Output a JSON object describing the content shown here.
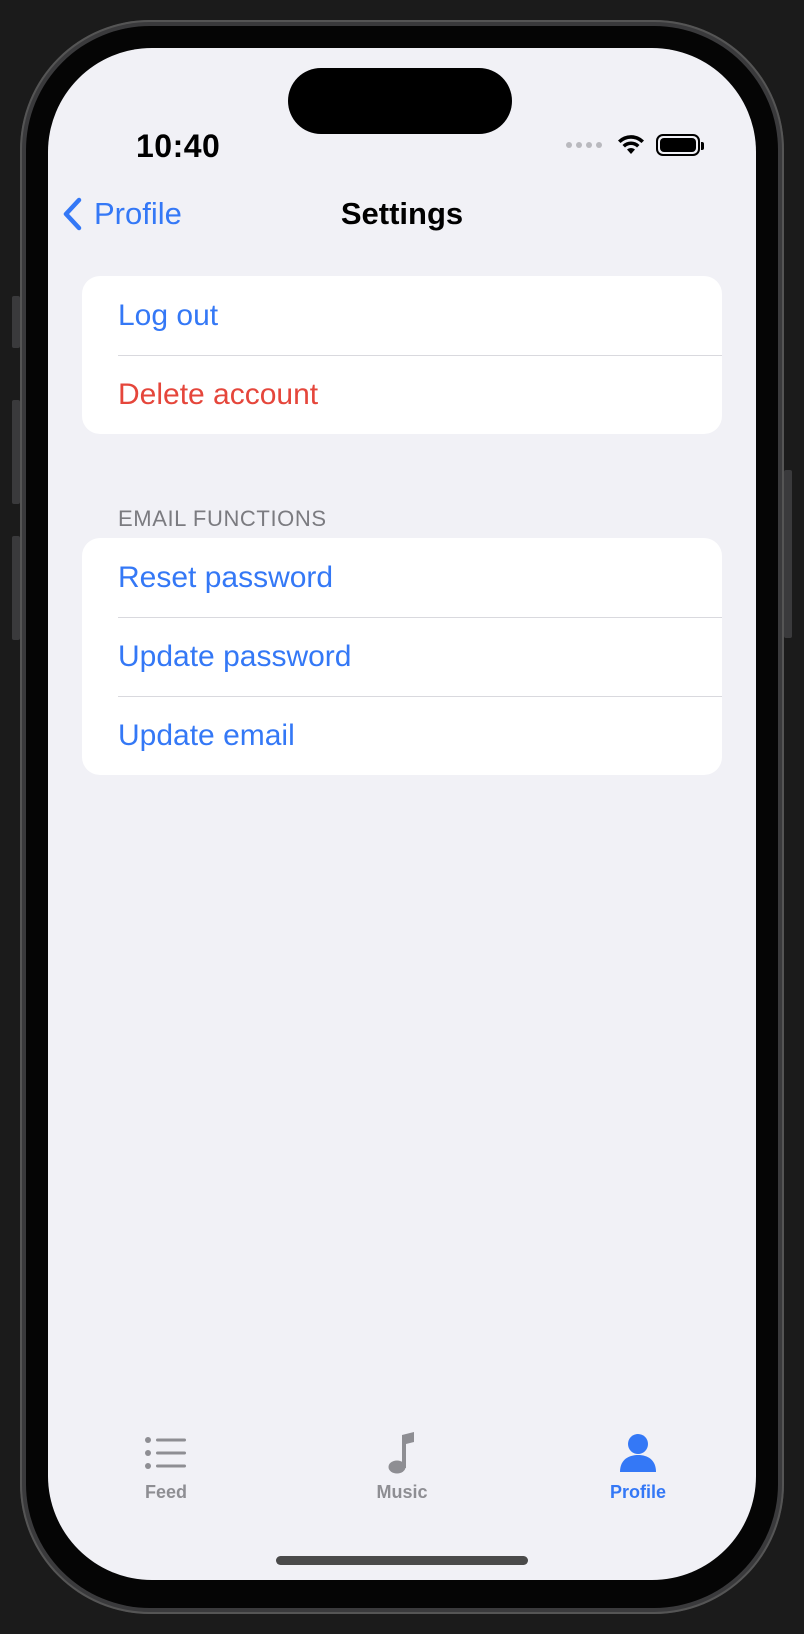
{
  "status_bar": {
    "time": "10:40"
  },
  "nav": {
    "back_label": "Profile",
    "title": "Settings"
  },
  "account_group": {
    "items": [
      {
        "label": "Log out",
        "style": "default"
      },
      {
        "label": "Delete account",
        "style": "destructive"
      }
    ]
  },
  "email_group": {
    "header": "EMAIL FUNCTIONS",
    "items": [
      {
        "label": "Reset password"
      },
      {
        "label": "Update password"
      },
      {
        "label": "Update email"
      }
    ]
  },
  "tab_bar": {
    "tabs": [
      {
        "label": "Feed",
        "icon": "list-icon",
        "active": false
      },
      {
        "label": "Music",
        "icon": "music-note-icon",
        "active": false
      },
      {
        "label": "Profile",
        "icon": "person-icon",
        "active": true
      }
    ]
  },
  "colors": {
    "accent": "#3478f6",
    "destructive": "#e5463b",
    "background": "#f1f1f6",
    "inactive_tab": "#8e8e93"
  }
}
